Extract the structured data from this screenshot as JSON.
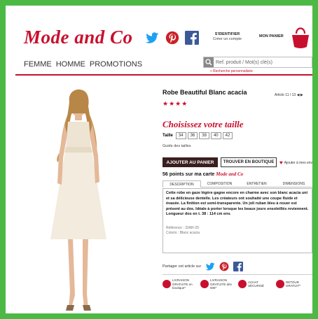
{
  "brand": {
    "logo_text": "Mode and Co"
  },
  "account": {
    "login": "S'IDENTIFIER",
    "register": "Créer un compte"
  },
  "cart": {
    "label": "MON PANIER"
  },
  "nav": {
    "items": [
      "FEMME",
      "HOMME",
      "PROMOTIONS"
    ]
  },
  "search": {
    "placeholder": "Ref. produit / Mot(s) clé(s)",
    "advanced": "» Recherche personnalisée"
  },
  "product": {
    "title": "Robe Beautiful Blanc acacia",
    "article": "Article  11 / 13",
    "prev_icon": "◀",
    "next_icon": "▶",
    "stars": "★★★★",
    "choose_size": "Choisissez votre taille",
    "size_label": "Taille",
    "sizes": [
      "34",
      "36",
      "38",
      "40",
      "42"
    ],
    "size_guide": "Guide des tailles",
    "add_to_cart": "AJOUTER AU PANIER",
    "find_in_store": "TROUVER EN BOUTIQUE",
    "wishlist": "Ajouter à mes envies",
    "points_text": "56 points sur ma carte",
    "points_brand": "Mode and Co",
    "tabs": [
      "DESCRIPTION",
      "COMPOSITION",
      "ENTRETIEN",
      "DIMENSIONS"
    ],
    "description": "Cette robe en gaze légère gagne encore en charme avec son blanc acacia uni et sa délicieuse dentelle. Les créateurs ont souhaité une coupe fluide et évasée. La finition est semi-transparente. Un joli ruban bleu à nouer est présent au dos. Idéale à porter lorsque les beaux jours ensoleillés reviennent. Longueur dos en t. 38 : 114 cm env.",
    "reference": "Référence : 32AR-25",
    "color": "Coloris : Blanc acacia"
  },
  "share": {
    "label": "Partager cet article sur"
  },
  "perks": [
    {
      "text": "LIVRAISON GRATUITE en boutique*"
    },
    {
      "text": "LIVRAISON GRATUITE dès 60€*"
    },
    {
      "text": "ACHAT SÉCURISÉ"
    },
    {
      "text": "RETOUR GRATUIT*"
    }
  ],
  "colors": {
    "frame": "#4cb944",
    "brand_red": "#c8102e",
    "cart_button": "#3a1f1e"
  }
}
